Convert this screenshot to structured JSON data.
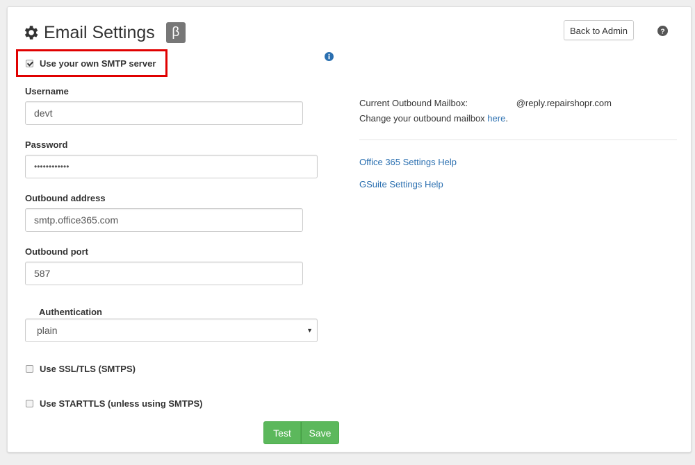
{
  "header": {
    "title": "Email Settings",
    "beta_badge": "β",
    "back_button": "Back to Admin"
  },
  "form": {
    "smtp_checkbox": {
      "label": "Use your own SMTP server",
      "checked": true
    },
    "username": {
      "label": "Username",
      "value": "devt"
    },
    "password": {
      "label": "Password",
      "value": "••••••••••••"
    },
    "outbound_address": {
      "label": "Outbound address",
      "value": "smtp.office365.com"
    },
    "outbound_port": {
      "label": "Outbound port",
      "value": "587"
    },
    "authentication": {
      "label": "Authentication",
      "selected": "plain"
    },
    "ssl_checkbox": {
      "label": "Use SSL/TLS (SMTPS)",
      "checked": false
    },
    "starttls_checkbox": {
      "label": "Use STARTTLS (unless using SMTPS)",
      "checked": false
    },
    "test_button": "Test",
    "save_button": "Save"
  },
  "info": {
    "mailbox_prefix": "Current Outbound Mailbox: ",
    "mailbox_domain": "@reply.repairshopr.com",
    "change_prefix": "Change your outbound mailbox ",
    "change_link": "here",
    "change_suffix": ".",
    "office365_link": "Office 365 Settings Help",
    "gsuite_link": "GSuite Settings Help"
  },
  "icons": {
    "title": "gear-icon",
    "help": "question-circle-icon",
    "info": "info-circle-icon",
    "select": "caret-down-icon"
  },
  "colors": {
    "highlight": "#e00000",
    "primary_button": "#5cb85c",
    "link": "#2a6fb0",
    "beta_badge": "#777777"
  }
}
